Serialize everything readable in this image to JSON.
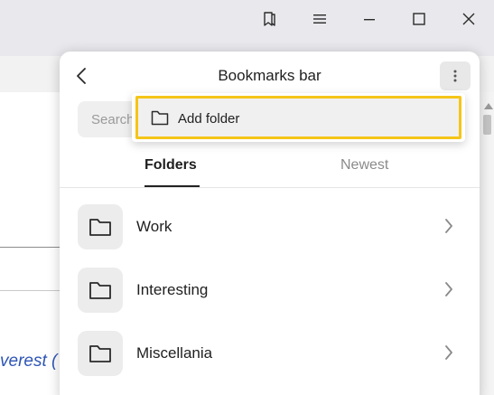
{
  "window": {
    "icons": [
      "bookmarks-icon",
      "menu-icon",
      "minimize-icon",
      "maximize-icon",
      "close-icon"
    ]
  },
  "background": {
    "link_text": "verest ("
  },
  "panel": {
    "title": "Bookmarks bar",
    "search_placeholder": "Search",
    "tabs": [
      {
        "label": "Folders",
        "active": true
      },
      {
        "label": "Newest",
        "active": false
      }
    ],
    "folders": [
      {
        "label": "Work"
      },
      {
        "label": "Interesting"
      },
      {
        "label": "Miscellania"
      }
    ]
  },
  "context_menu": {
    "items": [
      {
        "label": "Add folder",
        "icon": "folder-icon",
        "highlighted": true
      }
    ]
  },
  "colors": {
    "highlight_border": "#f5c518",
    "link": "#2e55b5"
  }
}
